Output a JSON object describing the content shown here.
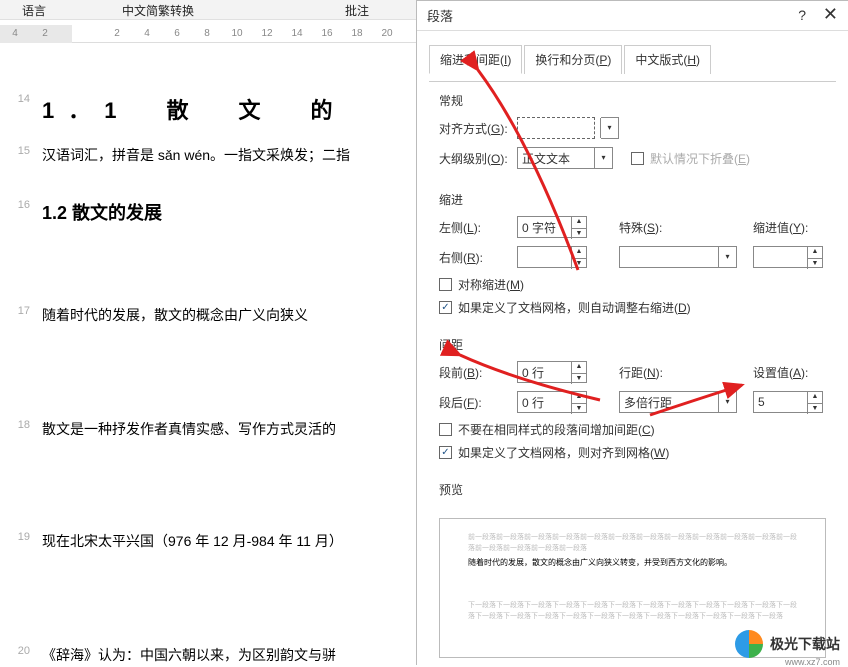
{
  "toolbar": {
    "t1": "语言",
    "t2": "中文简繁转换",
    "t3": "批注"
  },
  "ruler": [
    "4",
    "2",
    "",
    "2",
    "4",
    "6",
    "8",
    "10",
    "12",
    "14",
    "16",
    "18",
    "20"
  ],
  "doc": {
    "ln14": "14",
    "h1": "1．1　散　文　的",
    "ln15": "15",
    "p1": "汉语词汇，拼音是 sǎn wén。一指文采焕发；二指",
    "ln16": "16",
    "h2": "1.2 散文的发展",
    "ln17": "17",
    "p2": "随着时代的发展，散文的概念由广义向狭义",
    "ln18": "18",
    "p3": "散文是一种抒发作者真情实感、写作方式灵活的",
    "ln19": "19",
    "p4": "现在北宋太平兴国（976 年 12 月-984 年 11 月）",
    "ln20": "20",
    "p5": "《辞海》认为：中国六朝以来，为区别韵文与骈"
  },
  "dialog": {
    "title": "段落",
    "tabs": {
      "t1_a": "缩进和间距(",
      "t1_u": "I",
      "t1_b": ")",
      "t2_a": "换行和分页(",
      "t2_u": "P",
      "t2_b": ")",
      "t3_a": "中文版式(",
      "t3_u": "H",
      "t3_b": ")"
    },
    "section_general": "常规",
    "align_a": "对齐方式(",
    "align_u": "G",
    "align_b": "):",
    "outline_a": "大纲级别(",
    "outline_u": "O",
    "outline_b": "):",
    "outline_val": "正文文本",
    "collapse_a": "默认情况下折叠(",
    "collapse_u": "E",
    "collapse_b": ")",
    "section_indent": "缩进",
    "left_a": "左侧(",
    "left_u": "L",
    "left_b": "):",
    "left_val": "0 字符",
    "right_a": "右侧(",
    "right_u": "R",
    "right_b": "):",
    "special_a": "特殊(",
    "special_u": "S",
    "special_b": "):",
    "indentval_a": "缩进值(",
    "indentval_u": "Y",
    "indentval_b": "):",
    "mirror_a": "对称缩进(",
    "mirror_u": "M",
    "mirror_b": ")",
    "grid1_a": "如果定义了文档网格，则自动调整右缩进(",
    "grid1_u": "D",
    "grid1_b": ")",
    "section_spacing": "间距",
    "before_a": "段前(",
    "before_u": "B",
    "before_b": "):",
    "before_val": "0 行",
    "after_a": "段后(",
    "after_u": "F",
    "after_b": "):",
    "after_val": "0 行",
    "linesp_a": "行距(",
    "linesp_u": "N",
    "linesp_b": "):",
    "linesp_val": "多倍行距",
    "setval_a": "设置值(",
    "setval_u": "A",
    "setval_b": "):",
    "setval_val": "5",
    "nospace_a": "不要在相同样式的段落间增加间距(",
    "nospace_u": "C",
    "nospace_b": ")",
    "grid2_a": "如果定义了文档网格，则对齐到网格(",
    "grid2_u": "W",
    "grid2_b": ")",
    "section_preview": "预览",
    "preview_gray": "前一段落前一段落前一段落前一段落前一段落前一段落前一段落前一段落前一段落前一段落前一段落前一段落前一段落前一段落前一段落前一段落",
    "preview_main": "随着时代的发展，散文的概念由广义向狭义转变，并受到西方文化的影响。",
    "preview_gray2": "下一段落下一段落下一段落下一段落下一段落下一段落下一段落下一段落下一段落下一段落下一段落下一段落下一段落下一段落下一段落下一段落下一段落下一段落下一段落下一段落下一段落下一段落下一段落"
  },
  "logo": {
    "text": "极光下载站",
    "url": "www.xz7.com"
  }
}
